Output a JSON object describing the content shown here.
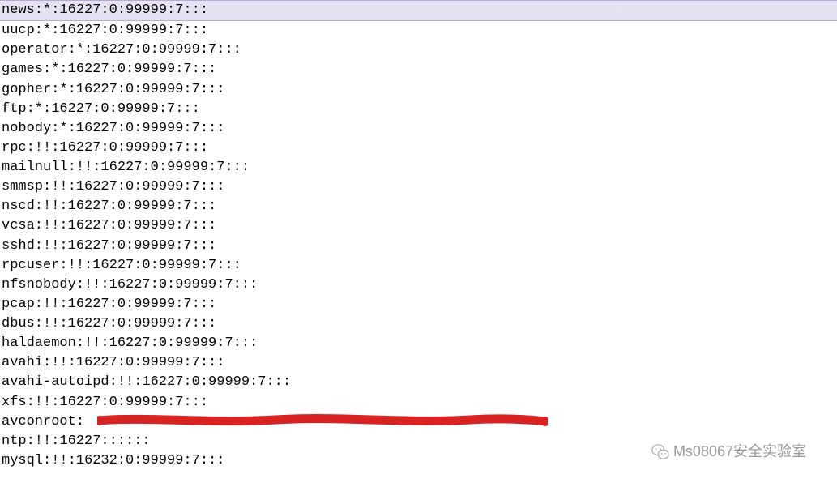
{
  "lines": [
    {
      "text": "news:*:16227:0:99999:7:::",
      "highlight": true
    },
    {
      "text": "uucp:*:16227:0:99999:7:::"
    },
    {
      "text": "operator:*:16227:0:99999:7:::"
    },
    {
      "text": "games:*:16227:0:99999:7:::"
    },
    {
      "text": "gopher:*:16227:0:99999:7:::"
    },
    {
      "text": "ftp:*:16227:0:99999:7:::"
    },
    {
      "text": "nobody:*:16227:0:99999:7:::"
    },
    {
      "text": "rpc:!!:16227:0:99999:7:::"
    },
    {
      "text": "mailnull:!!:16227:0:99999:7:::"
    },
    {
      "text": "smmsp:!!:16227:0:99999:7:::"
    },
    {
      "text": "nscd:!!:16227:0:99999:7:::"
    },
    {
      "text": "vcsa:!!:16227:0:99999:7:::"
    },
    {
      "text": "sshd:!!:16227:0:99999:7:::"
    },
    {
      "text": "rpcuser:!!:16227:0:99999:7:::"
    },
    {
      "text": "nfsnobody:!!:16227:0:99999:7:::"
    },
    {
      "text": "pcap:!!:16227:0:99999:7:::"
    },
    {
      "text": "dbus:!!:16227:0:99999:7:::"
    },
    {
      "text": "haldaemon:!!:16227:0:99999:7:::"
    },
    {
      "text": "avahi:!!:16227:0:99999:7:::"
    },
    {
      "text": "avahi-autoipd:!!:16227:0:99999:7:::"
    },
    {
      "text": "xfs:!!:16227:0:99999:7:::"
    },
    {
      "text": "avconroot:",
      "redacted": true
    },
    {
      "text": "ntp:!!:16227::::::"
    },
    {
      "text": "mysql:!!:16232:0:99999:7:::"
    }
  ],
  "watermark": {
    "text": "Ms08067安全实验室"
  },
  "colors": {
    "redaction": "#d72323",
    "highlight": "#e5e1f0"
  }
}
